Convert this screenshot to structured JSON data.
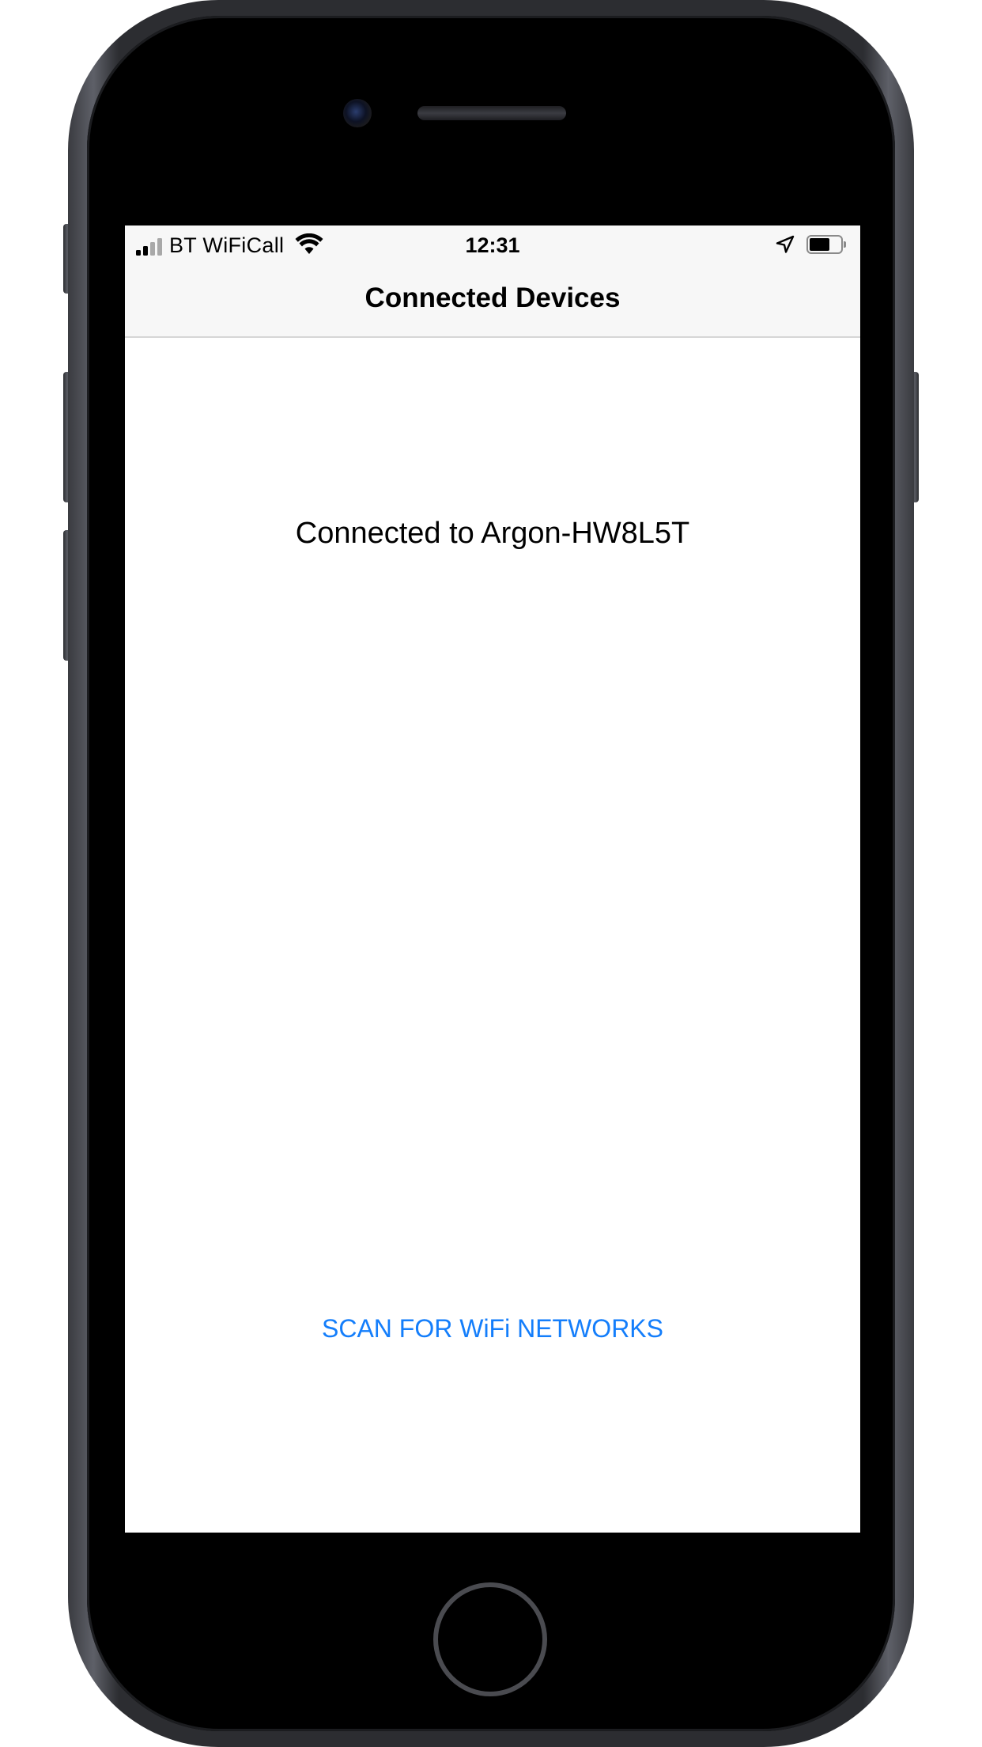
{
  "status_bar": {
    "carrier": "BT WiFiCall",
    "time": "12:31",
    "signal_bars_active": 2,
    "signal_bars_total": 4,
    "battery_level": 0.65,
    "icons": [
      "cellular-signal-icon",
      "wifi-icon",
      "location-arrow-icon",
      "battery-icon"
    ]
  },
  "navbar": {
    "title": "Connected Devices"
  },
  "main": {
    "connection_status": "Connected to Argon-HW8L5T",
    "scan_button_label": "SCAN FOR WiFi NETWORKS"
  },
  "colors": {
    "accent": "#147efb",
    "navbar_background": "#f7f7f7",
    "device_frame": "#2c2d31"
  }
}
